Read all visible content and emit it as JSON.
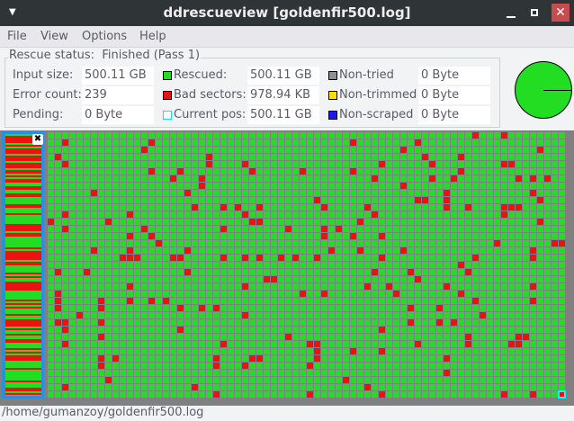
{
  "window": {
    "title": "ddrescueview [goldenfir500.log]"
  },
  "menu": [
    "File",
    "View",
    "Options",
    "Help"
  ],
  "status": {
    "legend_label": "Rescue status:",
    "legend_value": "Finished (Pass 1)",
    "input_size_label": "Input size:",
    "input_size": "500.11 GB",
    "error_count_label": "Error count:",
    "error_count": "239",
    "pending_label": "Pending:",
    "pending": "0 Byte",
    "rescued_label": "Rescued:",
    "rescued": "500.11 GB",
    "bad_sectors_label": "Bad sectors:",
    "bad_sectors": "978.94 KB",
    "current_pos_label": "Current pos:",
    "current_pos": "500.11 GB",
    "non_tried_label": "Non-tried",
    "non_tried": "0 Byte",
    "non_trimmed_label": "Non-trimmed",
    "non_trimmed": "0 Byte",
    "non_scraped_label": "Non-scraped",
    "non_scraped": "0 Byte"
  },
  "colors": {
    "rescued": "#22dd22",
    "bad": "#ee1111",
    "current": "#00ffff",
    "non_tried": "#808080",
    "non_trimmed": "#ffdd00",
    "non_scraped": "#1111ee"
  },
  "rescued_fraction": 0.999998,
  "statusbar": {
    "path": "/home/gumanzoy/goldenfir500.log"
  }
}
